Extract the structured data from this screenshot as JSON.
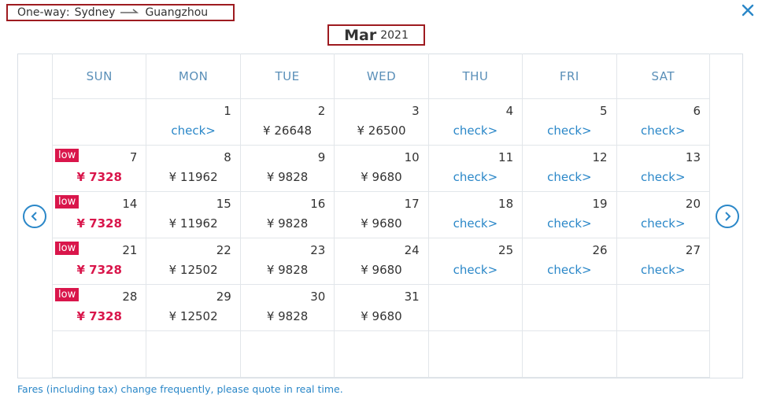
{
  "header": {
    "trip_type": "One-way",
    "origin": "Sydney",
    "destination": "Guangzhou",
    "close_icon": "close-icon"
  },
  "calendar": {
    "month": "Mar",
    "year": "2021",
    "weekdays": [
      "SUN",
      "MON",
      "TUE",
      "WED",
      "THU",
      "FRI",
      "SAT"
    ],
    "weeks": [
      [
        {
          "day": "",
          "price": ""
        },
        {
          "day": "1",
          "price": "check>",
          "kind": "check"
        },
        {
          "day": "2",
          "price": "¥ 26648",
          "kind": "fare"
        },
        {
          "day": "3",
          "price": "¥ 26500",
          "kind": "fare"
        },
        {
          "day": "4",
          "price": "check>",
          "kind": "check"
        },
        {
          "day": "5",
          "price": "check>",
          "kind": "check"
        },
        {
          "day": "6",
          "price": "check>",
          "kind": "check"
        }
      ],
      [
        {
          "day": "7",
          "price": "¥ 7328",
          "kind": "low",
          "badge": "low"
        },
        {
          "day": "8",
          "price": "¥ 11962",
          "kind": "fare"
        },
        {
          "day": "9",
          "price": "¥ 9828",
          "kind": "fare"
        },
        {
          "day": "10",
          "price": "¥ 9680",
          "kind": "fare"
        },
        {
          "day": "11",
          "price": "check>",
          "kind": "check"
        },
        {
          "day": "12",
          "price": "check>",
          "kind": "check"
        },
        {
          "day": "13",
          "price": "check>",
          "kind": "check"
        }
      ],
      [
        {
          "day": "14",
          "price": "¥ 7328",
          "kind": "low",
          "badge": "low"
        },
        {
          "day": "15",
          "price": "¥ 11962",
          "kind": "fare"
        },
        {
          "day": "16",
          "price": "¥ 9828",
          "kind": "fare"
        },
        {
          "day": "17",
          "price": "¥ 9680",
          "kind": "fare"
        },
        {
          "day": "18",
          "price": "check>",
          "kind": "check"
        },
        {
          "day": "19",
          "price": "check>",
          "kind": "check"
        },
        {
          "day": "20",
          "price": "check>",
          "kind": "check"
        }
      ],
      [
        {
          "day": "21",
          "price": "¥ 7328",
          "kind": "low",
          "badge": "low"
        },
        {
          "day": "22",
          "price": "¥ 12502",
          "kind": "fare"
        },
        {
          "day": "23",
          "price": "¥ 9828",
          "kind": "fare"
        },
        {
          "day": "24",
          "price": "¥ 9680",
          "kind": "fare"
        },
        {
          "day": "25",
          "price": "check>",
          "kind": "check"
        },
        {
          "day": "26",
          "price": "check>",
          "kind": "check"
        },
        {
          "day": "27",
          "price": "check>",
          "kind": "check"
        }
      ],
      [
        {
          "day": "28",
          "price": "¥ 7328",
          "kind": "low",
          "badge": "low"
        },
        {
          "day": "29",
          "price": "¥ 12502",
          "kind": "fare"
        },
        {
          "day": "30",
          "price": "¥ 9828",
          "kind": "fare"
        },
        {
          "day": "31",
          "price": "¥ 9680",
          "kind": "fare"
        },
        {
          "day": "",
          "price": ""
        },
        {
          "day": "",
          "price": ""
        },
        {
          "day": "",
          "price": ""
        }
      ],
      [
        {
          "day": "",
          "price": ""
        },
        {
          "day": "",
          "price": ""
        },
        {
          "day": "",
          "price": ""
        },
        {
          "day": "",
          "price": ""
        },
        {
          "day": "",
          "price": ""
        },
        {
          "day": "",
          "price": ""
        },
        {
          "day": "",
          "price": ""
        }
      ]
    ]
  },
  "nav": {
    "prev_icon": "chevron-left-circle-icon",
    "next_icon": "chevron-right-circle-icon"
  },
  "footer": {
    "note": "Fares (including tax) change frequently, please quote in real time."
  },
  "colors": {
    "accent": "#2a87c8",
    "low": "#d9164b",
    "highlight_border": "#9e1b20",
    "weekday_text": "#5a8fb8"
  }
}
